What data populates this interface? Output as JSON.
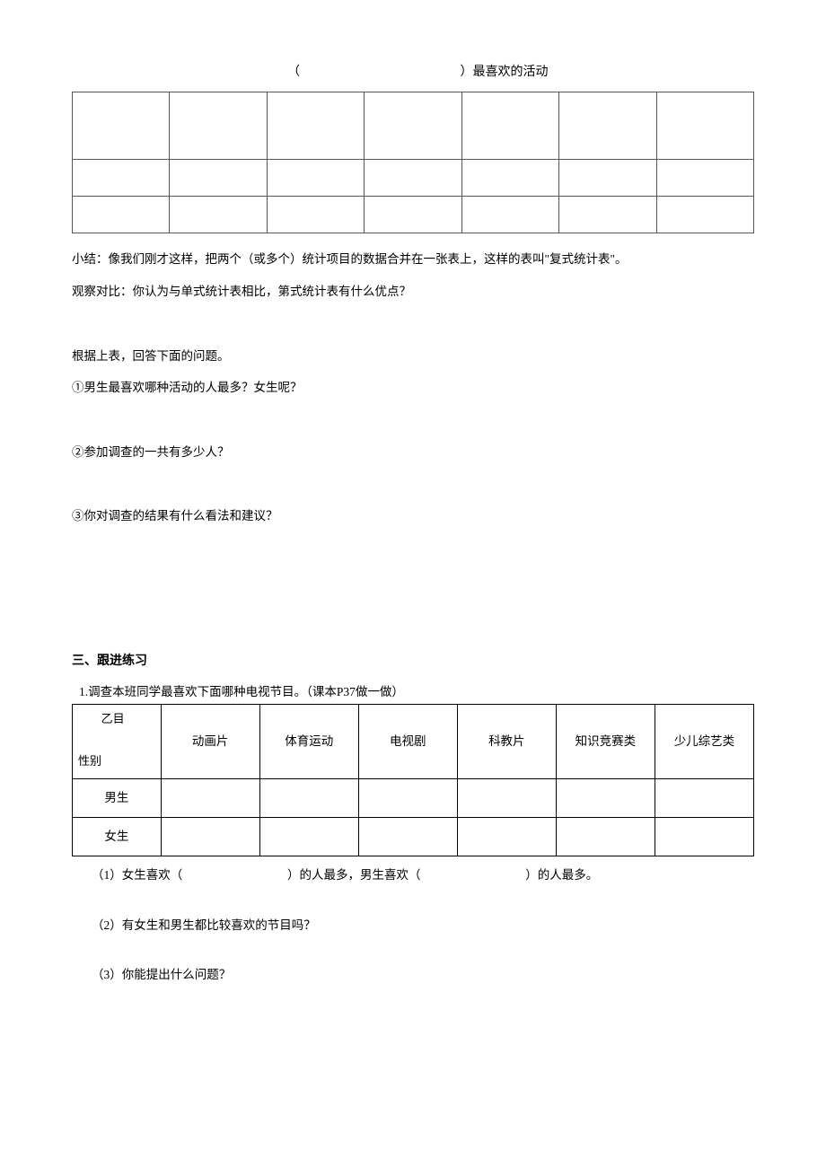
{
  "title_bracket_open": "（",
  "title_bracket_close": "）最喜欢的活动",
  "summary": "小结：像我们刚才这样，把两个（或多个）统计项目的数据合并在一张表上，这样的表叫\"复式统计表\"。",
  "compare": "观察对比：你认为与单式统计表相比，第式统计表有什么优点？",
  "answer_prompt": "根据上表，回答下面的问题。",
  "q1": "①男生最喜欢哪种活动的人最多？女生呢？",
  "q2": "②参加调查的一共有多少人？",
  "q3": "③你对调查的结果有什么看法和建议？",
  "section3_heading": "三、跟进练习",
  "exercise1_intro": "1.调查本班同学最喜欢下面哪种电视节目。（课本P37做一做）",
  "corner_top": "乙目",
  "corner_bottom": "性别",
  "columns": [
    "动画片",
    "体育运动",
    "电视剧",
    "科教片",
    "知识竞赛类",
    "少儿综艺类"
  ],
  "row_male": "男生",
  "row_female": "女生",
  "sub_q1_a": "（1）女生喜欢（",
  "sub_q1_b": "）的人最多，男生喜欢（",
  "sub_q1_c": "）的人最多。",
  "sub_q2": "（2）有女生和男生都比较喜欢的节目吗？",
  "sub_q3": "（3）你能提出什么问题？"
}
